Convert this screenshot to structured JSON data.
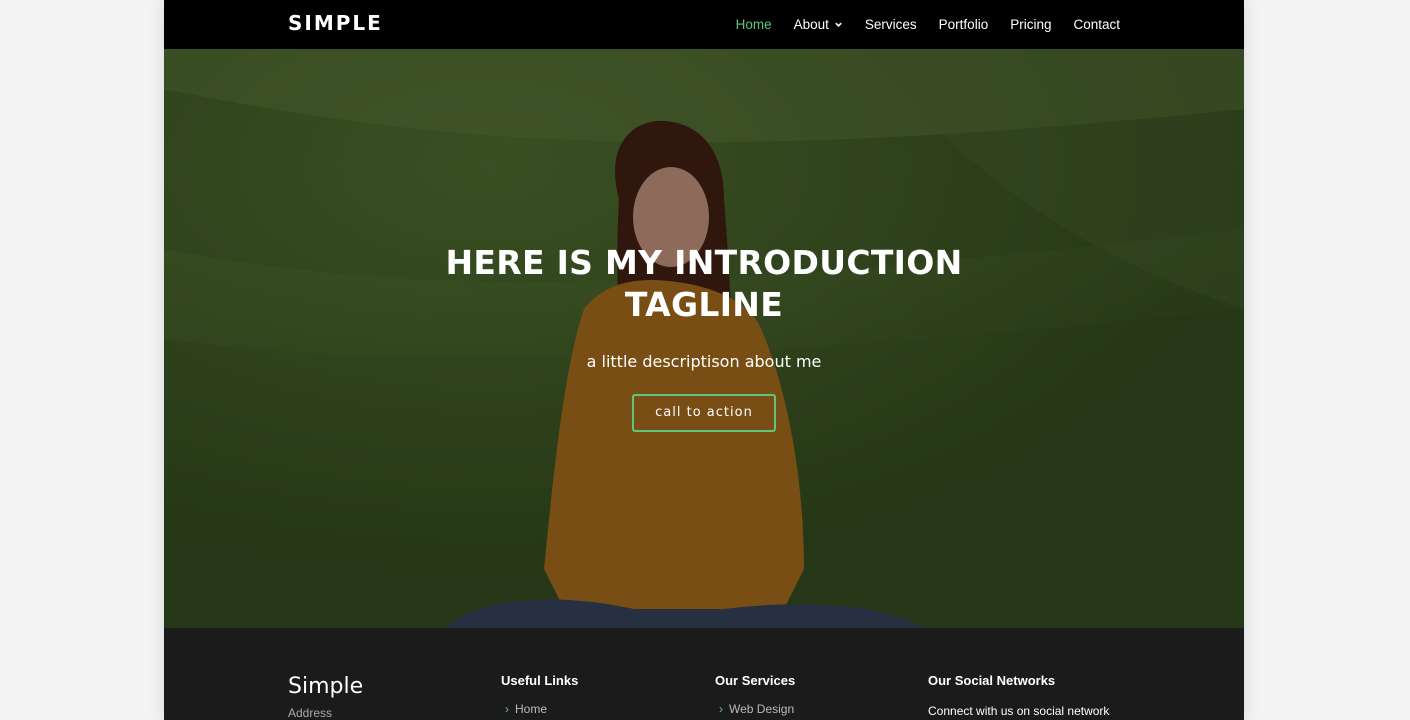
{
  "header": {
    "logo": "SIMPLE",
    "nav": [
      {
        "label": "Home",
        "active": true
      },
      {
        "label": "About",
        "dropdown": true
      },
      {
        "label": "Services"
      },
      {
        "label": "Portfolio"
      },
      {
        "label": "Pricing"
      },
      {
        "label": "Contact"
      }
    ]
  },
  "hero": {
    "title_line1": "HERE IS MY INTRODUCTION",
    "title_line2": "TAGLINE",
    "subtitle": "a little descriptison about me",
    "cta_label": "call to action"
  },
  "footer": {
    "brand": "Simple",
    "address_label": "Address",
    "useful_links": {
      "heading": "Useful Links",
      "first_link": "Home"
    },
    "services": {
      "heading": "Our Services",
      "first_link": "Web Design"
    },
    "social": {
      "heading": "Our Social Networks",
      "text": "Connect with us on social network"
    }
  },
  "colors": {
    "accent": "#5ec77b",
    "header_bg": "#000000",
    "footer_bg": "#1b1b1b"
  },
  "icons": {
    "dropdown": "chevron-down-icon",
    "link_bullet": "chevron-right-icon"
  }
}
